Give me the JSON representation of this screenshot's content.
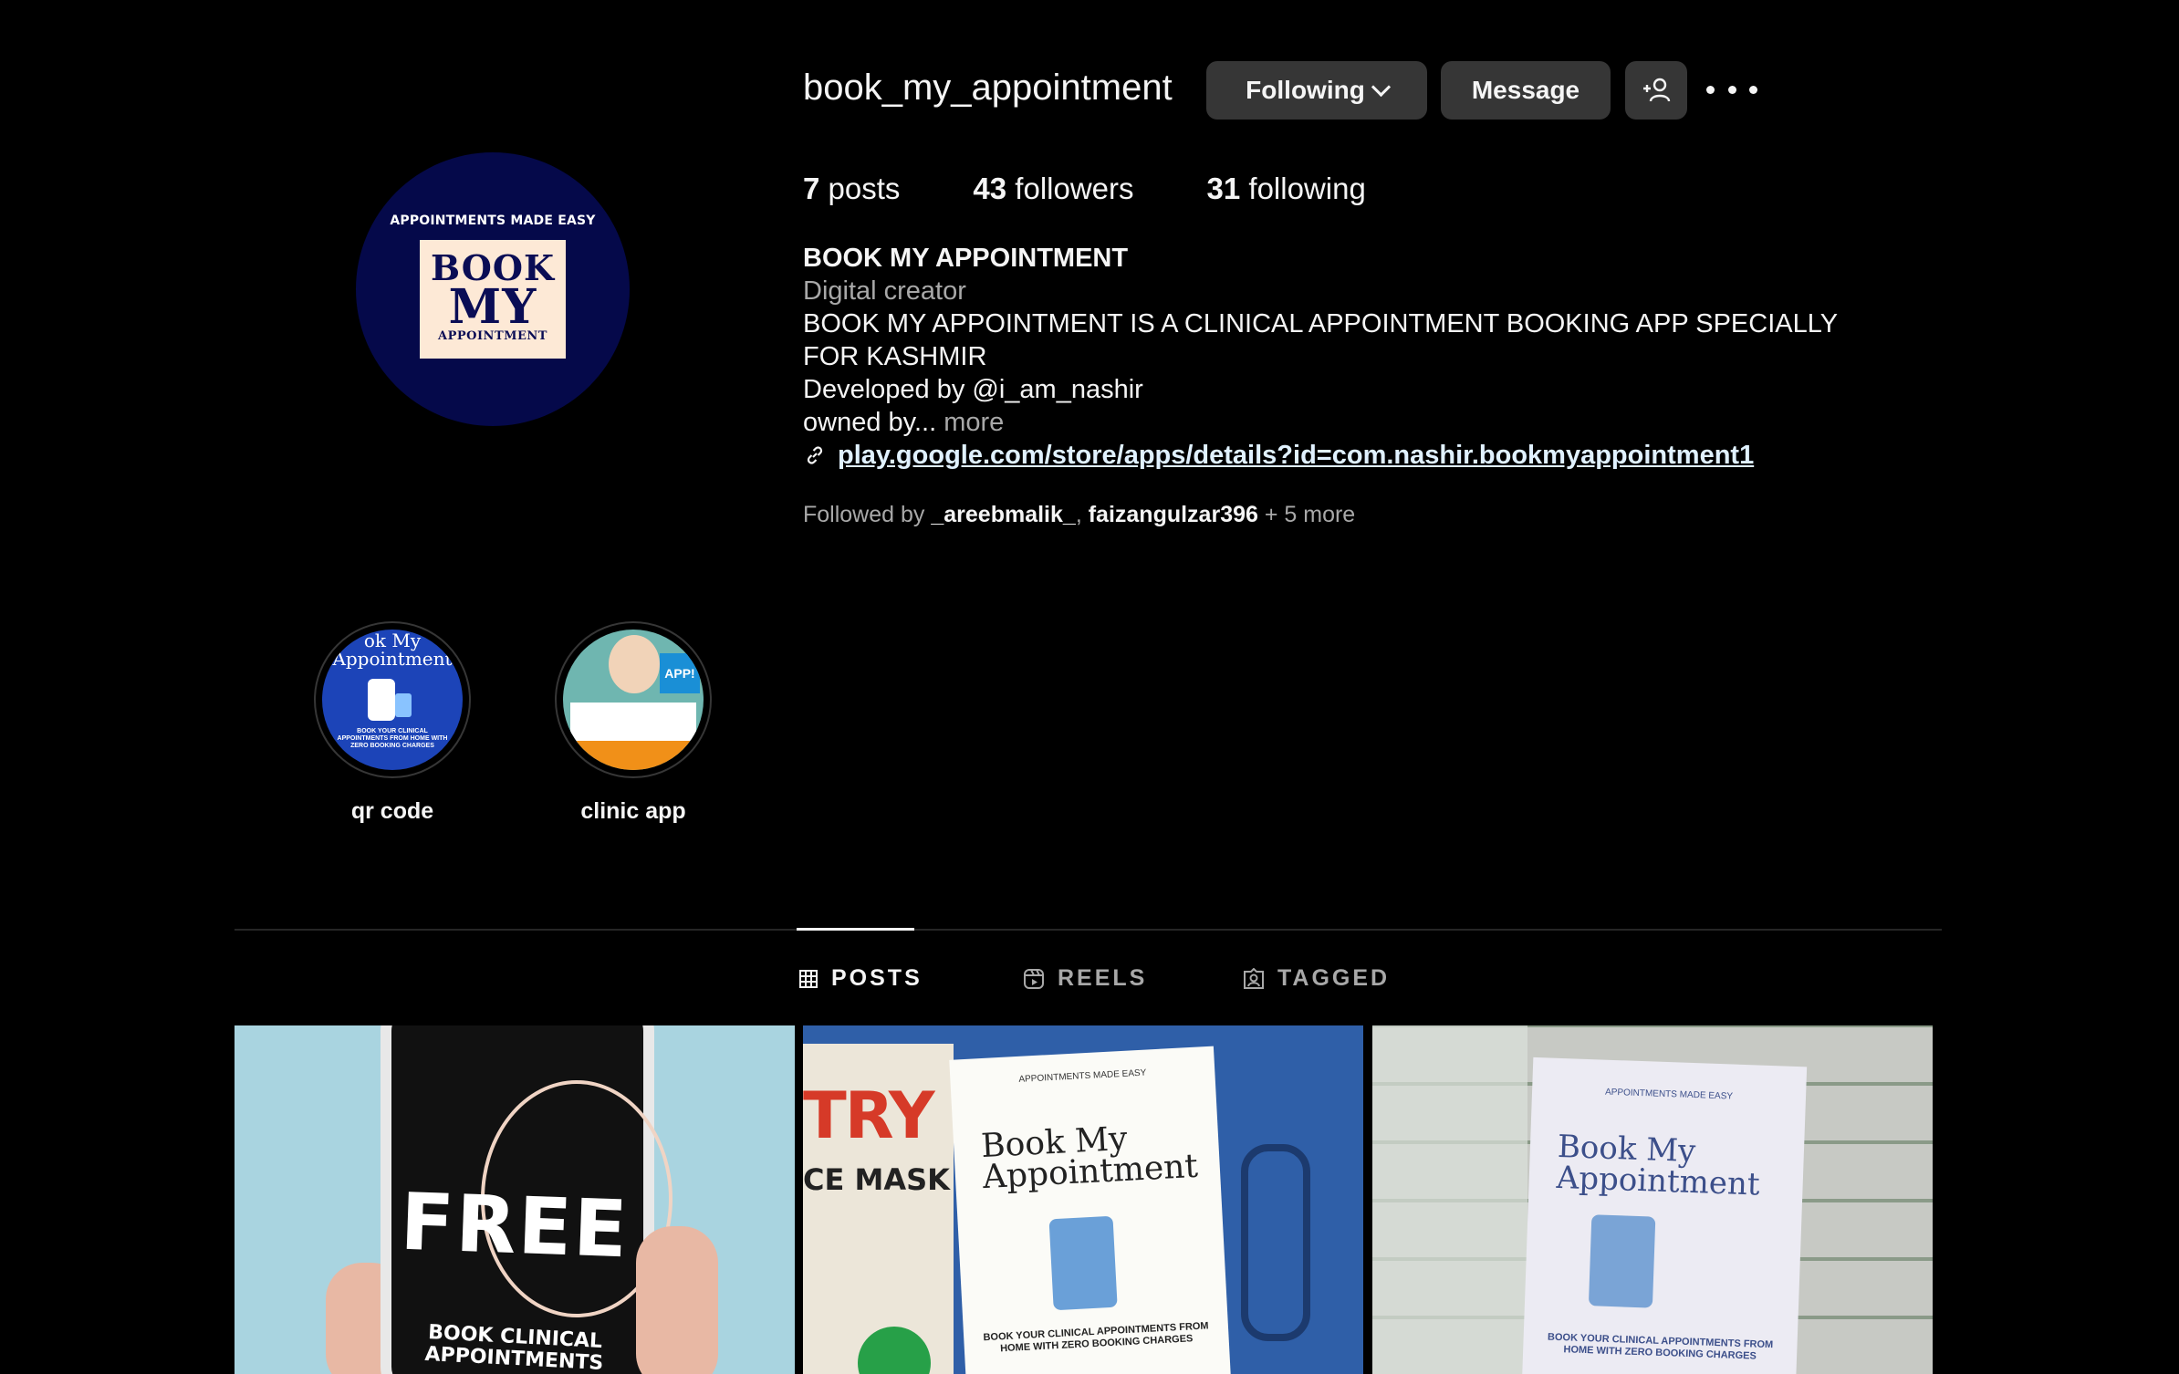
{
  "profile": {
    "username": "book_my_appointment",
    "avatar": {
      "tagline": "APPOINTMENTS MADE EASY",
      "logo_line1": "BOOK",
      "logo_line2": "MY",
      "logo_line3": "APPOINTMENT"
    },
    "buttons": {
      "following": "Following",
      "message": "Message"
    },
    "stats": {
      "posts_count": "7",
      "posts_label": "posts",
      "followers_count": "43",
      "followers_label": "followers",
      "following_count": "31",
      "following_label": "following"
    },
    "bio": {
      "name": "BOOK MY APPOINTMENT",
      "category": "Digital creator",
      "line1": "BOOK MY APPOINTMENT IS A CLINICAL APPOINTMENT BOOKING APP SPECIALLY FOR KASHMIR",
      "line2": "Developed by @i_am_nashir",
      "line3": "owned by...",
      "more": "more",
      "link": "play.google.com/store/apps/details?id=com.nashir.bookmyappointment1"
    },
    "followed_by": {
      "prefix": "Followed by",
      "user1": "_areebmalik_",
      "separator": ",",
      "user2": "faizangulzar396",
      "suffix": "+ 5 more"
    }
  },
  "highlights": [
    {
      "label": "qr code",
      "thumb_text": "ok My\nAppointment",
      "thumb_small": "BOOK YOUR CLINICAL APPOINTMENTS FROM HOME WITH ZERO BOOKING CHARGES"
    },
    {
      "label": "clinic app",
      "thumb_badge": "APP!"
    }
  ],
  "tabs": [
    {
      "label": "POSTS",
      "icon": "grid-icon",
      "active": true
    },
    {
      "label": "REELS",
      "icon": "reels-icon",
      "active": false
    },
    {
      "label": "TAGGED",
      "icon": "tagged-icon",
      "active": false
    }
  ],
  "posts": [
    {
      "headline": "FREE",
      "sub": "BOOK CLINICAL\nAPPOINTMENTS"
    },
    {
      "side_text1": "TRY",
      "side_text2": "CE MASK",
      "small": "APPOINTMENTS MADE EASY",
      "title": "Book My\nAppointment",
      "bottom": "BOOK YOUR CLINICAL APPOINTMENTS FROM HOME WITH ZERO BOOKING CHARGES"
    },
    {
      "small": "APPOINTMENTS MADE EASY",
      "title": "Book My\nAppointment",
      "bottom": "BOOK YOUR CLINICAL APPOINTMENTS FROM HOME WITH ZERO BOOKING CHARGES"
    }
  ],
  "colors": {
    "background": "#000000",
    "button_bg": "#363636",
    "muted_text": "#a8a8a8",
    "link_text": "#e0f1ff",
    "avatar_bg": "#05094a"
  }
}
